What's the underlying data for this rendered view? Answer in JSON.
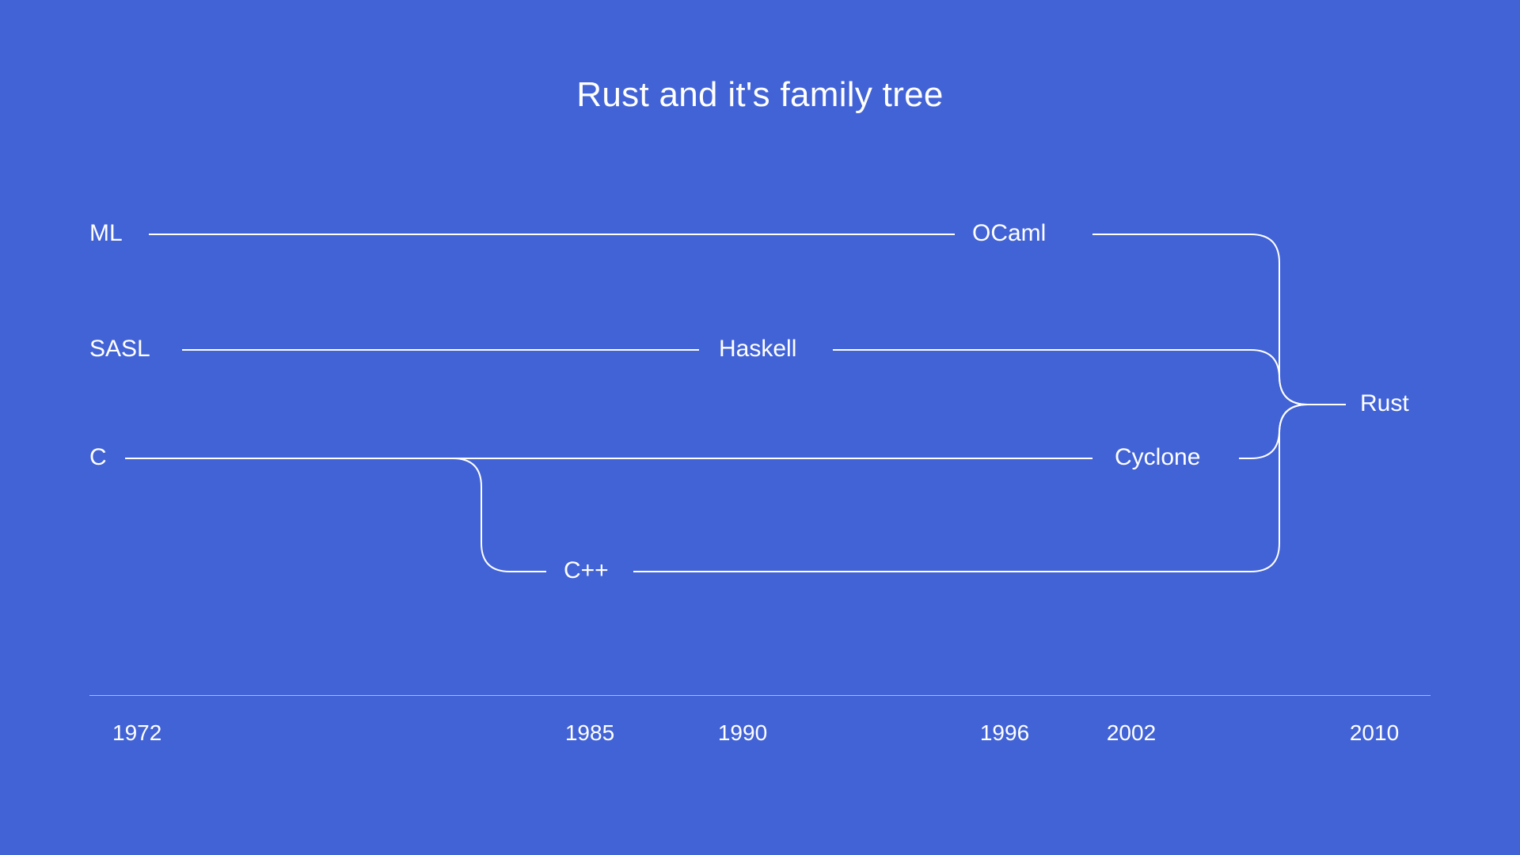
{
  "title": "Rust and it's family tree",
  "nodes": {
    "ml": "ML",
    "sasl": "SASL",
    "c": "C",
    "ocaml": "OCaml",
    "haskell": "Haskell",
    "cyclone": "Cyclone",
    "cpp": "C++",
    "rust": "Rust"
  },
  "timeline": {
    "y1972": "1972",
    "y1985": "1985",
    "y1990": "1990",
    "y1996": "1996",
    "y2002": "2002",
    "y2010": "2010"
  }
}
